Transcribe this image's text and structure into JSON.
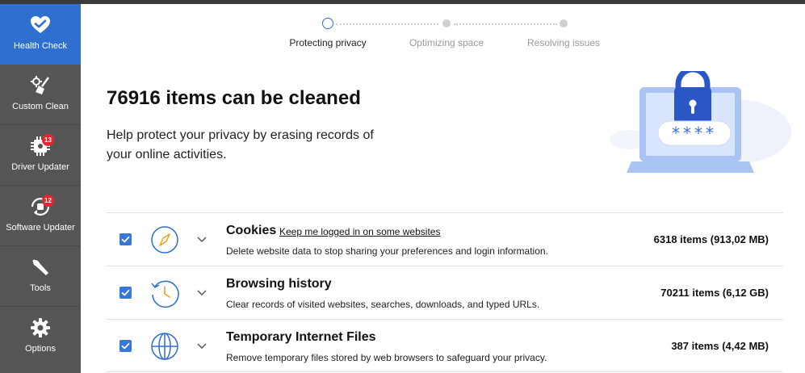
{
  "sidebar": {
    "items": [
      {
        "label": "Health Check",
        "icon": "heart-icon",
        "badge": null,
        "active": true
      },
      {
        "label": "Custom Clean",
        "icon": "broom-icon",
        "badge": null,
        "active": false
      },
      {
        "label": "Driver Updater",
        "icon": "gear-chip-icon",
        "badge": "13",
        "active": false
      },
      {
        "label": "Software Updater",
        "icon": "refresh-app-icon",
        "badge": "12",
        "active": false
      },
      {
        "label": "Tools",
        "icon": "wrench-icon",
        "badge": null,
        "active": false
      },
      {
        "label": "Options",
        "icon": "gear-icon",
        "badge": null,
        "active": false
      }
    ]
  },
  "steps": [
    {
      "label": "Protecting privacy",
      "state": "current"
    },
    {
      "label": "Optimizing space",
      "state": "pending"
    },
    {
      "label": "Resolving issues",
      "state": "pending"
    }
  ],
  "main": {
    "headline": "76916 items can be cleaned",
    "subtext": "Help protect your privacy by erasing records of your online activities.",
    "hero_password_mask": "****"
  },
  "rows": [
    {
      "title": "Cookies",
      "link": "Keep me logged in on some websites",
      "desc": "Delete website data to stop sharing your preferences and login information.",
      "count": "6318 items (913,02 MB)",
      "icon": "compass-icon",
      "checked": true
    },
    {
      "title": "Browsing history",
      "link": null,
      "desc": "Clear records of visited websites, searches, downloads, and typed URLs.",
      "count": "70211 items (6,12 GB)",
      "icon": "history-clock-icon",
      "checked": true
    },
    {
      "title": "Temporary Internet Files",
      "link": null,
      "desc": "Remove temporary files stored by web browsers to safeguard your privacy.",
      "count": "387 items (4,42 MB)",
      "icon": "globe-icon",
      "checked": true
    }
  ],
  "colors": {
    "accent": "#2f6fd0",
    "sidebar": "#555555",
    "badge": "#e3262f",
    "checkbox": "#3a78d8"
  }
}
